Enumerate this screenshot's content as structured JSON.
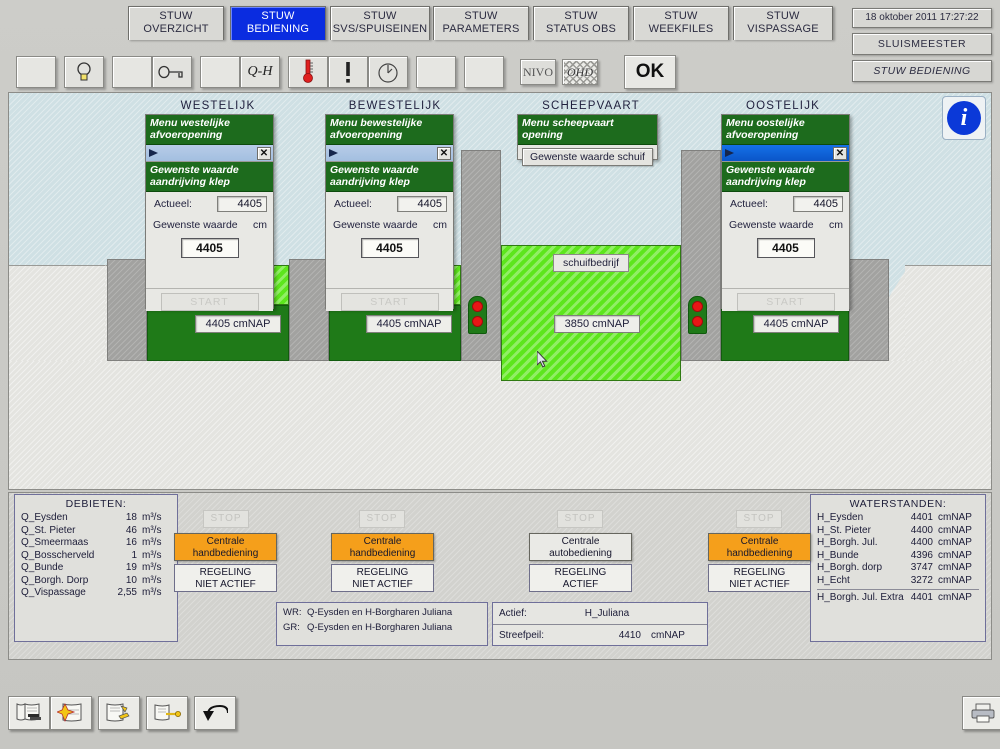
{
  "header": {
    "tabs": [
      {
        "line1": "STUW",
        "line2": "OVERZICHT",
        "active": false
      },
      {
        "line1": "STUW",
        "line2": "BEDIENING",
        "active": true
      },
      {
        "line1": "STUW",
        "line2": "SVS/SPUISEINEN",
        "active": false
      },
      {
        "line1": "STUW",
        "line2": "PARAMETERS",
        "active": false
      },
      {
        "line1": "STUW",
        "line2": "STATUS OBS",
        "active": false
      },
      {
        "line1": "STUW",
        "line2": "WEEKFILES",
        "active": false
      },
      {
        "line1": "STUW",
        "line2": "VISPASSAGE",
        "active": false
      }
    ],
    "datetime": "18 oktober 2011 17:27:22",
    "operator": "SLUISMEESTER",
    "screen": "STUW BEDIENING",
    "active_tab_color": "#0a2ce0"
  },
  "toolbar": {
    "qh_label": "Q-H",
    "nivo_label": "NIVO",
    "ohd_label": "OHD",
    "ok_label": "OK",
    "icons": [
      "blank-icon",
      "lightbulb-icon",
      "blank-icon",
      "key-icon",
      "blank-icon",
      "qh-icon",
      "thermometer-icon",
      "alarm-icon",
      "clock-icon",
      "blank-icon"
    ]
  },
  "diagram": {
    "columns": [
      {
        "title": "WESTELIJK"
      },
      {
        "title": "BEWESTELIJK"
      },
      {
        "title": "SCHEEPVAART"
      },
      {
        "title": "OOSTELIJK"
      }
    ],
    "nap_values": [
      "4405 cmNAP",
      "4405 cmNAP",
      "3850 cmNAP",
      "4405 cmNAP"
    ],
    "schuifbedrijf_label": "schuifbedrijf",
    "info_icon_label": "i"
  },
  "dialogs": [
    {
      "menu_title": "Menu westelijke\nafvoeropening",
      "menu_line1": "Menu westelijke",
      "menu_line2": "afvoeropening",
      "titlebar_active": false,
      "close_label": "✕",
      "section_line1": "Gewenste waarde",
      "section_line2": "aandrijving klep",
      "actueel_label": "Actueel:",
      "actueel_value": "4405",
      "gewenste_label": "Gewenste waarde",
      "unit": "cm",
      "gewenste_value": "4405",
      "start_label": "START"
    },
    {
      "menu_line1": "Menu bewestelijke",
      "menu_line2": "afvoeropening",
      "titlebar_active": false,
      "close_label": "✕",
      "section_line1": "Gewenste waarde",
      "section_line2": "aandrijving klep",
      "actueel_label": "Actueel:",
      "actueel_value": "4405",
      "gewenste_label": "Gewenste waarde",
      "unit": "cm",
      "gewenste_value": "4405",
      "start_label": "START"
    },
    {
      "menu_line1": "Menu scheepvaart",
      "menu_line2": "opening",
      "button_label": "Gewenste waarde schuif"
    },
    {
      "menu_line1": "Menu oostelijke",
      "menu_line2": "afvoeropening",
      "titlebar_active": true,
      "close_label": "✕",
      "section_line1": "Gewenste waarde",
      "section_line2": "aandrijving klep",
      "actueel_label": "Actueel:",
      "actueel_value": "4405",
      "gewenste_label": "Gewenste waarde",
      "unit": "cm",
      "gewenste_value": "4405",
      "start_label": "START"
    }
  ],
  "debieten": {
    "title": "DEBIETEN:",
    "unit": "m³/s",
    "rows": [
      {
        "name": "Q_Eysden",
        "value": "18"
      },
      {
        "name": "Q_St. Pieter",
        "value": "46"
      },
      {
        "name": "Q_Smeermaas",
        "value": "16"
      },
      {
        "name": "Q_Bosscherveld",
        "value": "1"
      },
      {
        "name": "Q_Bunde",
        "value": "19"
      },
      {
        "name": "Q_Borgh. Dorp",
        "value": "10"
      },
      {
        "name": "Q_Vispassage",
        "value": "2,55"
      }
    ]
  },
  "waterstanden": {
    "title": "WATERSTANDEN:",
    "unit": "cmNAP",
    "rows": [
      {
        "name": "H_Eysden",
        "value": "4401"
      },
      {
        "name": "H_St. Pieter",
        "value": "4400"
      },
      {
        "name": "H_Borgh. Jul.",
        "value": "4400"
      },
      {
        "name": "H_Bunde",
        "value": "4396"
      },
      {
        "name": "H_Borgh. dorp",
        "value": "3747"
      },
      {
        "name": "H_Echt",
        "value": "3272"
      },
      {
        "name": "H_Borgh. Jul. Extra",
        "value": "4401"
      }
    ]
  },
  "controls": {
    "stop_label": "STOP",
    "groups": [
      {
        "mode_line1": "Centrale",
        "mode_line2": "handbediening",
        "mode_type": "hand",
        "reg_line1": "REGELING",
        "reg_line2": "NIET ACTIEF"
      },
      {
        "mode_line1": "Centrale",
        "mode_line2": "handbediening",
        "mode_type": "hand",
        "reg_line1": "REGELING",
        "reg_line2": "NIET ACTIEF"
      },
      {
        "mode_line1": "Centrale",
        "mode_line2": "autobediening",
        "mode_type": "auto",
        "reg_line1": "REGELING",
        "reg_line2": "ACTIEF"
      },
      {
        "mode_line1": "Centrale",
        "mode_line2": "handbediening",
        "mode_type": "hand",
        "reg_line1": "REGELING",
        "reg_line2": "NIET ACTIEF"
      }
    ],
    "hand_color": "#f59f1b"
  },
  "regeling_info": {
    "wr_key": "WR:",
    "wr_value": "Q-Eysden en H-Borgharen Juliana",
    "gr_key": "GR:",
    "gr_value": "Q-Eysden en H-Borgharen Juliana",
    "actief_key": "Actief:",
    "actief_value": "H_Juliana",
    "streefpeil_key": "Streefpeil:",
    "streefpeil_value": "4410",
    "streefpeil_unit": "cmNAP"
  },
  "bottom_toolbar": {
    "icons": [
      "report-stack-icon",
      "report-new-icon",
      "report-edit-icon",
      "report-key-icon",
      "undo-arrow-icon",
      "print-icon"
    ]
  }
}
